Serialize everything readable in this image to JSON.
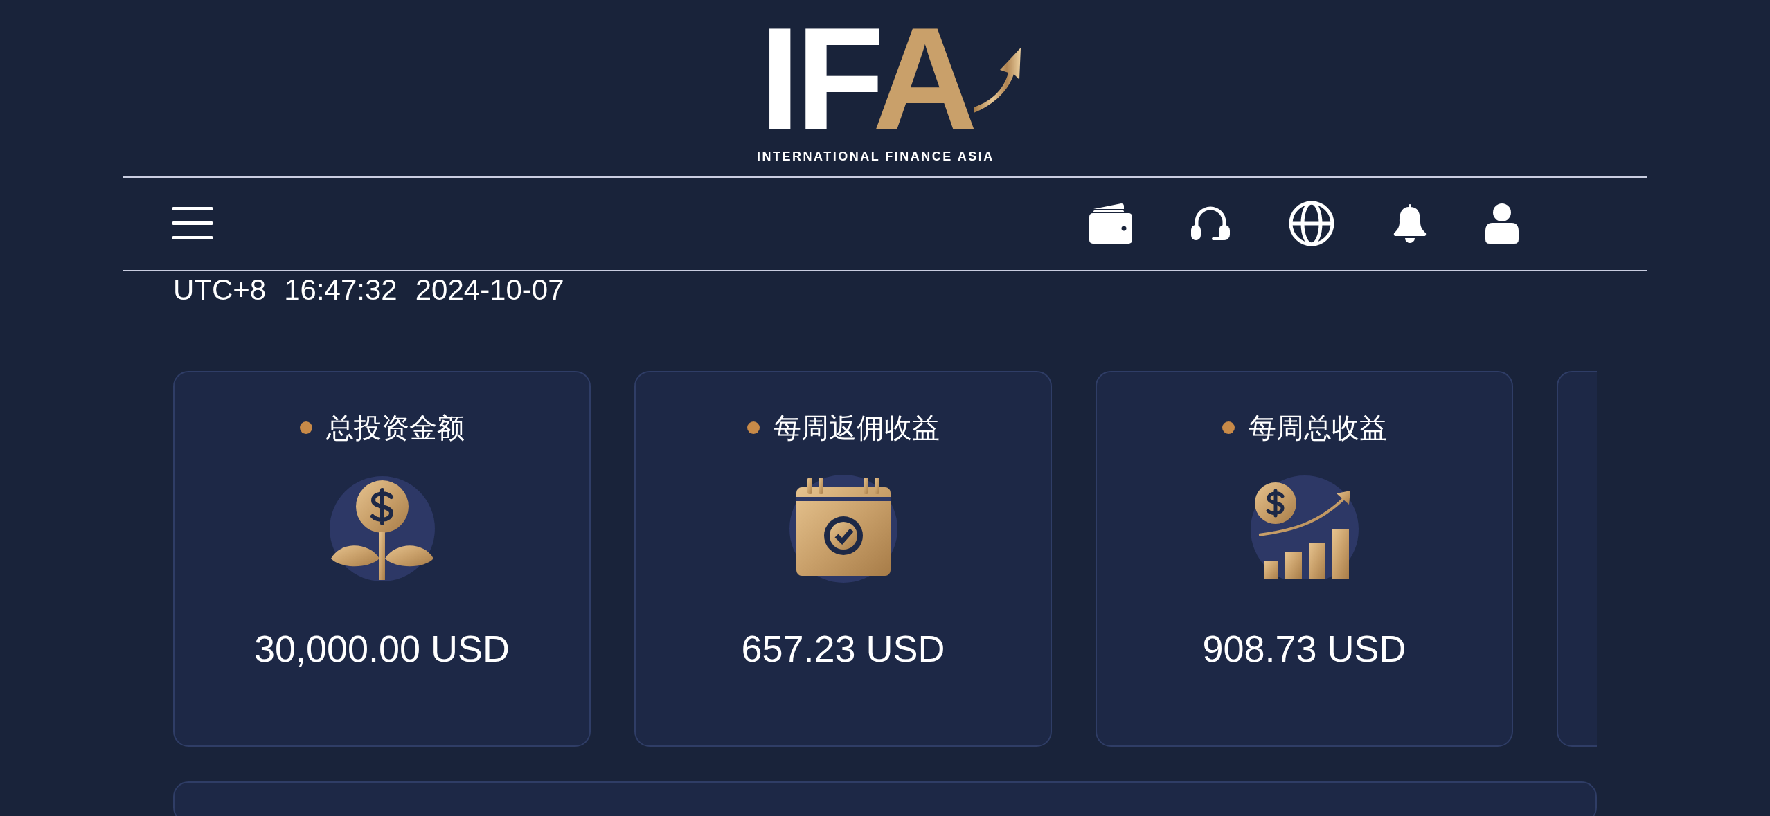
{
  "logo": {
    "mark": "IFA",
    "tagline": "INTERNATIONAL FINANCE ASIA"
  },
  "clock": {
    "timezone": "UTC+8",
    "time": "16:47:32",
    "date": "2024-10-07"
  },
  "cards": [
    {
      "kind": "plant",
      "title": "总投资金额",
      "value": "30,000.00 USD"
    },
    {
      "kind": "calendar",
      "title": "每周返佣收益",
      "value": "657.23 USD"
    },
    {
      "kind": "growth",
      "title": "每周总收益",
      "value": "908.73 USD"
    }
  ]
}
